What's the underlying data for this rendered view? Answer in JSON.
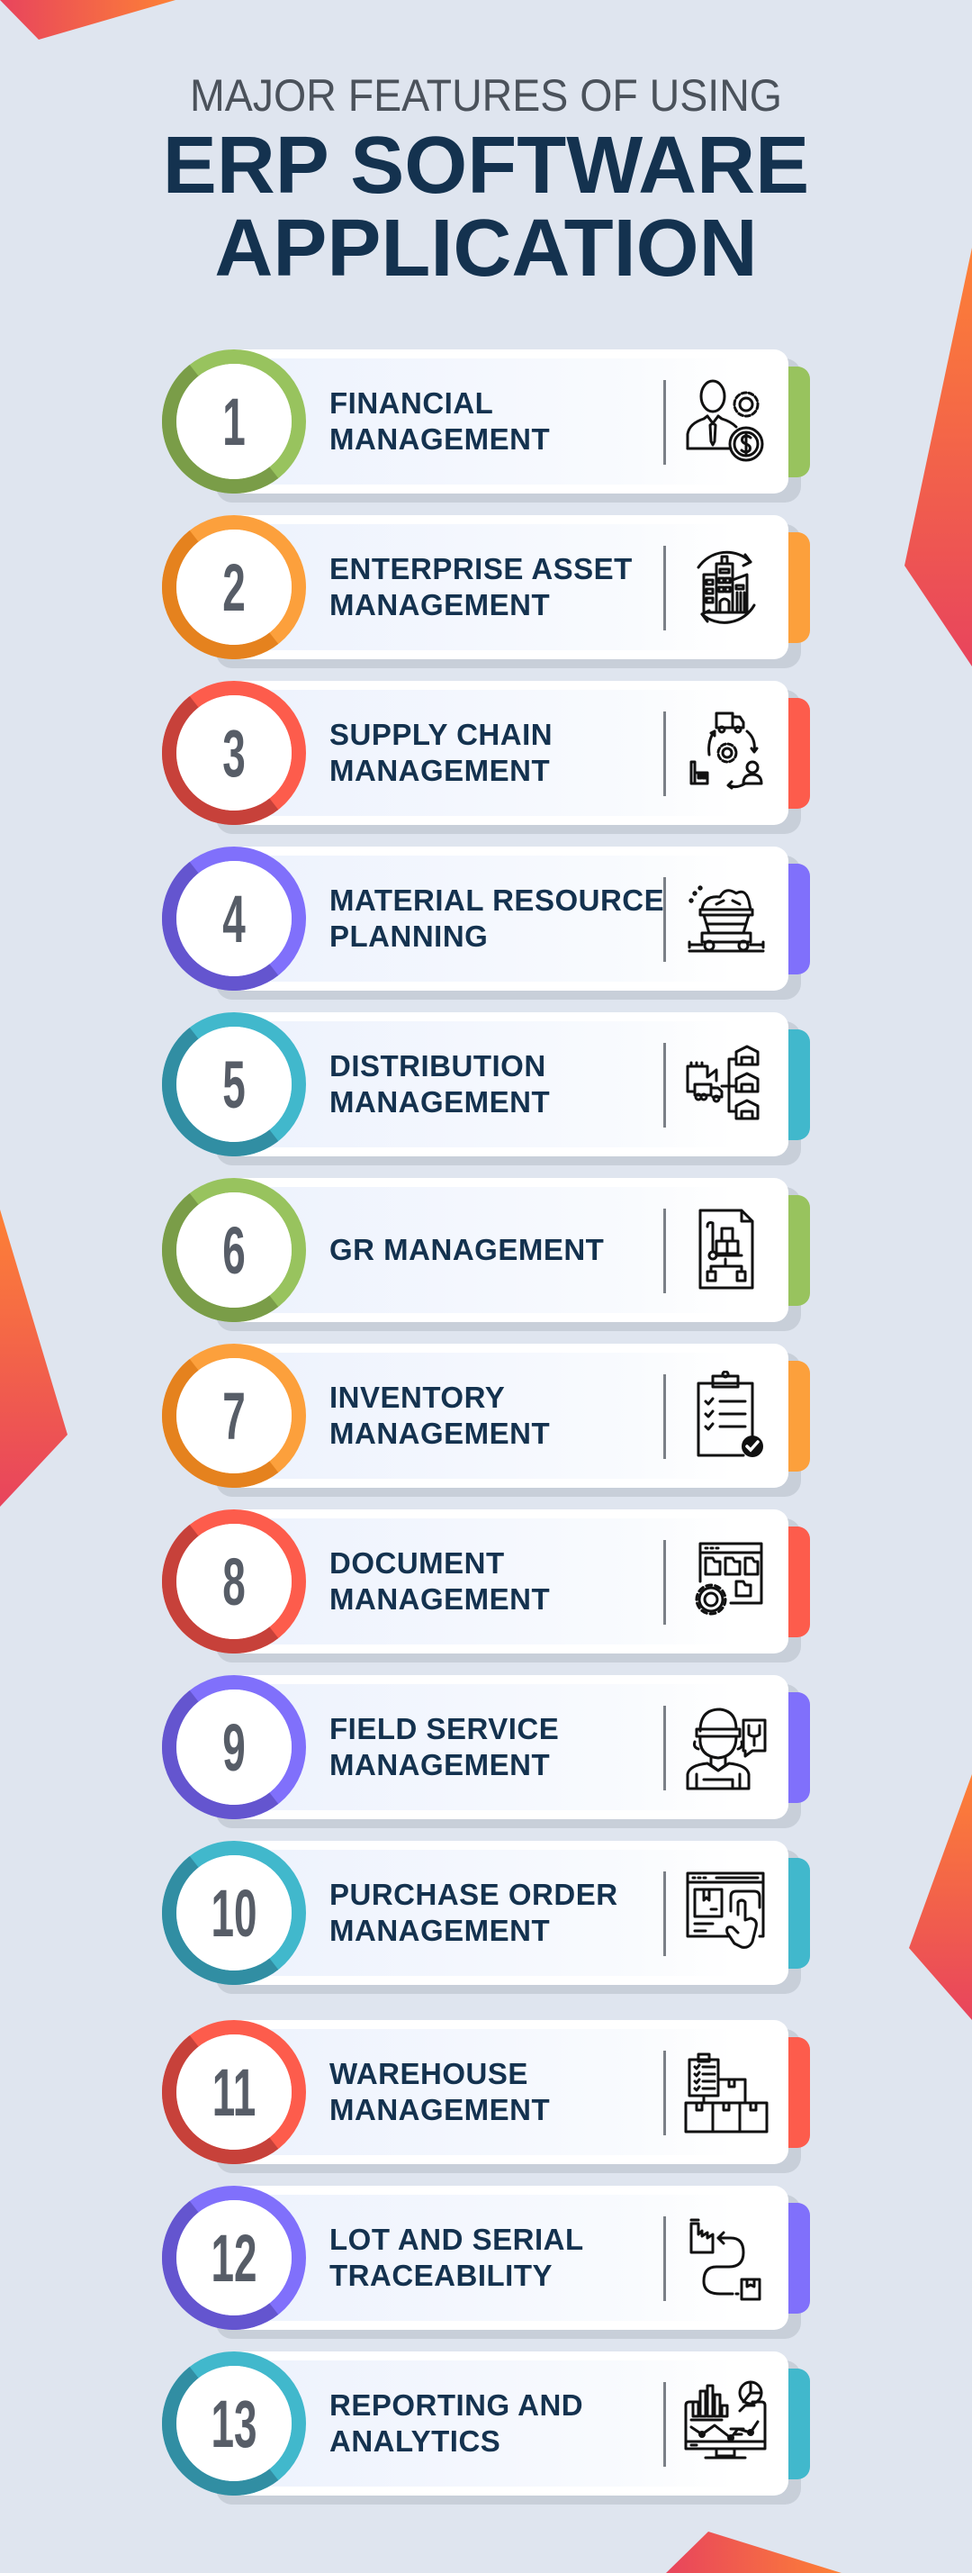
{
  "header": {
    "subtitle": "MAJOR FEATURES OF USING",
    "title_line1": "ERP SOFTWARE",
    "title_line2": "APPLICATION"
  },
  "colors": {
    "background": "#dfe5ef",
    "title": "#14324f",
    "subtitle": "#4b525b",
    "number": "#575d67",
    "decoration_start": "#fd8136",
    "decoration_end": "#e8445d"
  },
  "features": [
    {
      "number": "1",
      "line1": "FINANCIAL",
      "line2": "MANAGEMENT",
      "icon": "financial-manager-icon",
      "color": "#98c35e",
      "dark": "#7a9d48"
    },
    {
      "number": "2",
      "line1": "ENTERPRISE ASSET",
      "line2": "MANAGEMENT",
      "icon": "building-cycle-icon",
      "color": "#fca03c",
      "dark": "#e5821e"
    },
    {
      "number": "3",
      "line1": "SUPPLY CHAIN",
      "line2": "MANAGEMENT",
      "icon": "supply-chain-cycle-icon",
      "color": "#fd5c4c",
      "dark": "#c7413a"
    },
    {
      "number": "4",
      "line1": "MATERIAL RESOURCE",
      "line2": "PLANNING",
      "icon": "mine-cart-icon",
      "color": "#8070fb",
      "dark": "#6455cf"
    },
    {
      "number": "5",
      "line1": "DISTRIBUTION",
      "line2": "MANAGEMENT",
      "icon": "distribution-network-icon",
      "color": "#41b8cc",
      "dark": "#318ea3"
    },
    {
      "number": "6",
      "line1": "GR MANAGEMENT",
      "line2": "",
      "icon": "goods-receipt-document-icon",
      "color": "#98c35e",
      "dark": "#7a9d48"
    },
    {
      "number": "7",
      "line1": "INVENTORY",
      "line2": "MANAGEMENT",
      "icon": "clipboard-checklist-icon",
      "color": "#fca03c",
      "dark": "#e5821e"
    },
    {
      "number": "8",
      "line1": "DOCUMENT",
      "line2": "MANAGEMENT",
      "icon": "folder-settings-icon",
      "color": "#fd5c4c",
      "dark": "#c7413a"
    },
    {
      "number": "9",
      "line1": "FIELD SERVICE",
      "line2": "MANAGEMENT",
      "icon": "service-technician-icon",
      "color": "#8070fb",
      "dark": "#6455cf"
    },
    {
      "number": "10",
      "line1": "PURCHASE ORDER",
      "line2": "MANAGEMENT",
      "icon": "online-order-icon",
      "color": "#41b8cc",
      "dark": "#318ea3"
    },
    {
      "number": "11",
      "line1": "WAREHOUSE",
      "line2": "MANAGEMENT",
      "icon": "warehouse-boxes-icon",
      "color": "#fd5c4c",
      "dark": "#c7413a"
    },
    {
      "number": "12",
      "line1": "LOT AND SERIAL",
      "line2": "TRACEABILITY",
      "icon": "traceability-path-icon",
      "color": "#8070fb",
      "dark": "#6455cf"
    },
    {
      "number": "13",
      "line1": "REPORTING AND",
      "line2": "ANALYTICS",
      "icon": "analytics-monitor-icon",
      "color": "#41b8cc",
      "dark": "#318ea3"
    }
  ]
}
